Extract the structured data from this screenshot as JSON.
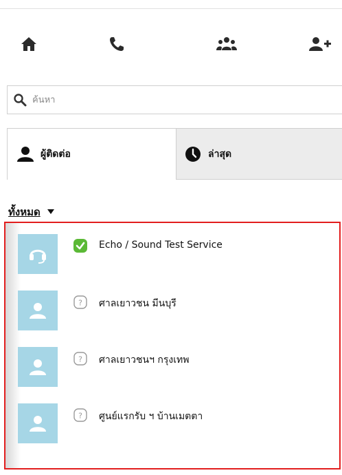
{
  "nav": {
    "items": [
      {
        "icon": "home-icon"
      },
      {
        "icon": "phone-icon"
      },
      {
        "icon": "group-icon"
      },
      {
        "icon": "add-contact-icon"
      }
    ]
  },
  "search": {
    "placeholder": "ค้นหา",
    "value": ""
  },
  "tabs": [
    {
      "label": "ผู้ติดต่อ",
      "icon": "person-icon",
      "selected": true
    },
    {
      "label": "ล่าสุด",
      "icon": "clock-icon",
      "selected": false
    }
  ],
  "filter": {
    "label": "ทั้งหมด",
    "icon": "caret-down-icon"
  },
  "contacts": [
    {
      "name": "Echo / Sound Test Service",
      "avatar": "headset-icon",
      "status": "online-status-icon"
    },
    {
      "name": "ศาลเยาวชน มีนบุรี",
      "avatar": "person-avatar-icon",
      "status": "unknown-status-icon"
    },
    {
      "name": "ศาลเยาวชนฯ กรุงเทพ",
      "avatar": "person-avatar-icon",
      "status": "unknown-status-icon"
    },
    {
      "name": "ศูนย์แรกรับ ฯ บ้านเมตตา",
      "avatar": "person-avatar-icon",
      "status": "unknown-status-icon"
    }
  ],
  "colors": {
    "highlight": "#e21d1d",
    "avatar_bg": "#a6d6e6",
    "online_green": "#5bb936",
    "icon_dark": "#2b2b2b"
  }
}
